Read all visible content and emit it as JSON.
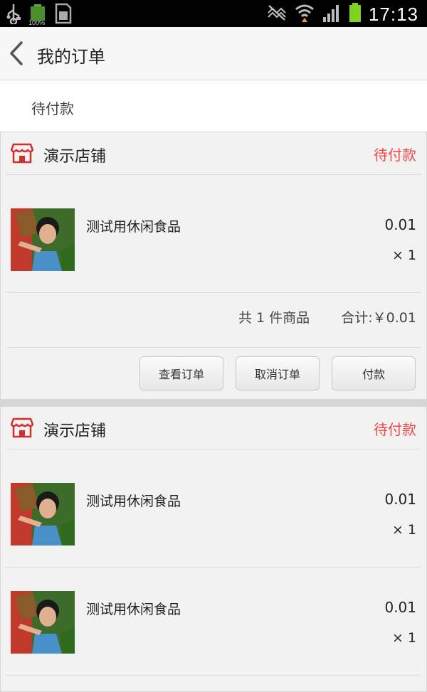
{
  "status_bar": {
    "time": "17:13",
    "battery_small": "100%",
    "icons": [
      "usb-icon",
      "battery-small-icon",
      "sim-card-icon",
      "mute-icon",
      "wifi-icon",
      "signal-icon",
      "battery-icon"
    ]
  },
  "header": {
    "title": "我的订单",
    "back_icon": "chevron-left-icon"
  },
  "filter": {
    "label": "待付款"
  },
  "orders": [
    {
      "store": "演示店铺",
      "status": "待付款",
      "items": [
        {
          "name": "测试用休闲食品",
          "price": "0.01",
          "qty": "× 1"
        }
      ],
      "summary": {
        "count": "共  1 件商品",
        "total": "合计:￥0.01"
      },
      "buttons": {
        "view": "查看订单",
        "cancel": "取消订单",
        "pay": "付款"
      }
    },
    {
      "store": "演示店铺",
      "status": "待付款",
      "items": [
        {
          "name": "测试用休闲食品",
          "price": "0.01",
          "qty": "× 1"
        },
        {
          "name": "测试用休闲食品",
          "price": "0.01",
          "qty": "× 1"
        }
      ]
    }
  ],
  "colors": {
    "accent": "#f04848",
    "store_icon": "#d32f2f"
  }
}
